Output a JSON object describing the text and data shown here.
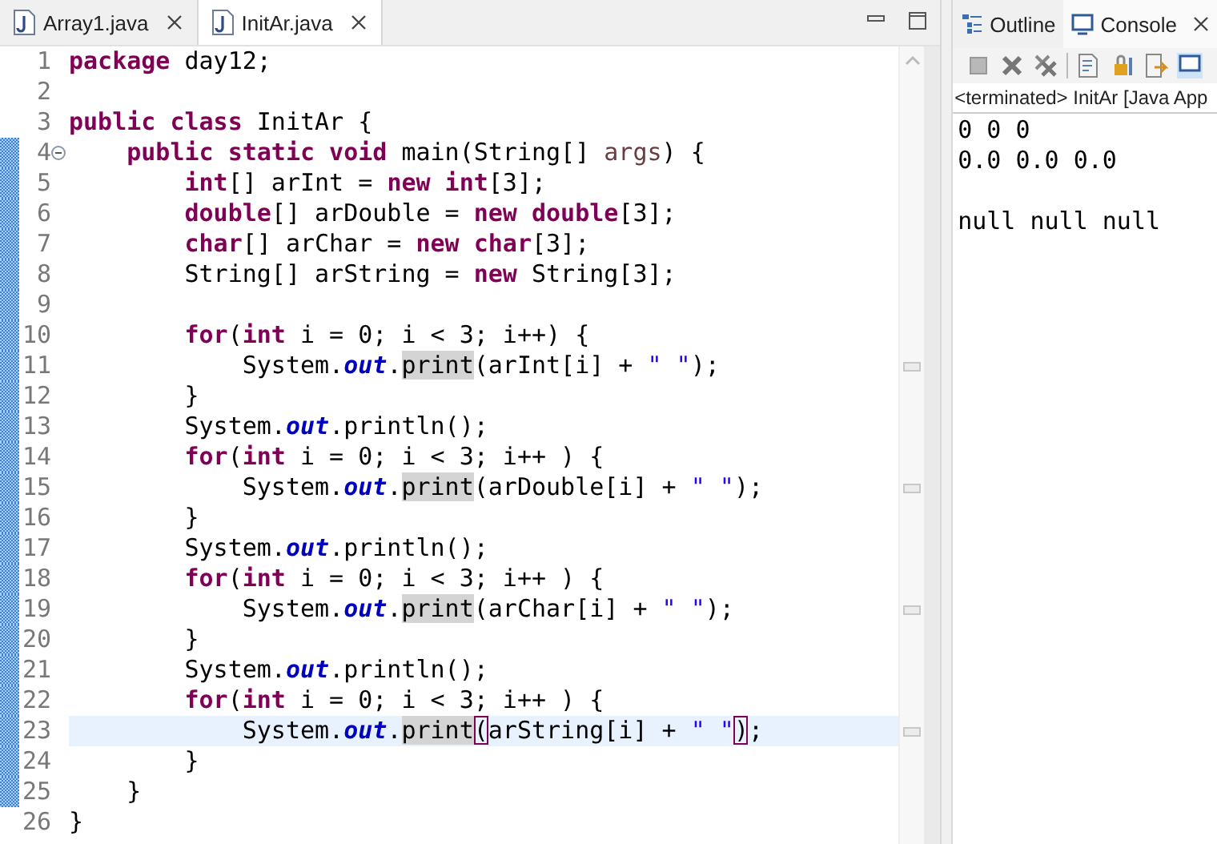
{
  "editor": {
    "tabs": [
      {
        "label": "Array1.java",
        "selected": false
      },
      {
        "label": "InitAr.java",
        "selected": true
      }
    ],
    "lines": [
      {
        "number": "1",
        "changed": false,
        "fold": false,
        "current": false,
        "tokens": [
          {
            "kind": "kw",
            "text": "package"
          },
          {
            "kind": "plain",
            "text": " day12;"
          }
        ]
      },
      {
        "number": "2",
        "changed": false,
        "fold": false,
        "current": false
      },
      {
        "number": "3",
        "changed": false,
        "fold": false,
        "current": false,
        "tokens": [
          {
            "kind": "kw",
            "text": "public class"
          },
          {
            "kind": "plain",
            "text": " InitAr {"
          }
        ]
      },
      {
        "number": "4",
        "changed": true,
        "fold": true,
        "current": false,
        "tokens": [
          {
            "kind": "kw",
            "text": "    public static void"
          },
          {
            "kind": "plain",
            "text": " main(String[] "
          },
          {
            "kind": "param",
            "text": "args"
          },
          {
            "kind": "plain",
            "text": ") {"
          }
        ]
      },
      {
        "number": "5",
        "changed": true,
        "fold": false,
        "current": false,
        "tokens": [
          {
            "kind": "kw",
            "text": "        int"
          },
          {
            "kind": "plain",
            "text": "[] arInt = "
          },
          {
            "kind": "kw",
            "text": "new int"
          },
          {
            "kind": "plain",
            "text": "[3];"
          }
        ]
      },
      {
        "number": "6",
        "changed": true,
        "fold": false,
        "current": false,
        "tokens": [
          {
            "kind": "kw",
            "text": "        double"
          },
          {
            "kind": "plain",
            "text": "[] arDouble = "
          },
          {
            "kind": "kw",
            "text": "new double"
          },
          {
            "kind": "plain",
            "text": "[3];"
          }
        ]
      },
      {
        "number": "7",
        "changed": true,
        "fold": false,
        "current": false,
        "tokens": [
          {
            "kind": "kw",
            "text": "        char"
          },
          {
            "kind": "plain",
            "text": "[] arChar = "
          },
          {
            "kind": "kw",
            "text": "new char"
          },
          {
            "kind": "plain",
            "text": "[3];"
          }
        ]
      },
      {
        "number": "8",
        "changed": true,
        "fold": false,
        "current": false,
        "tokens": [
          {
            "kind": "plain",
            "text": "        String[] arString = "
          },
          {
            "kind": "kw",
            "text": "new"
          },
          {
            "kind": "plain",
            "text": " String[3];"
          }
        ]
      },
      {
        "number": "9",
        "changed": true,
        "fold": false,
        "current": false
      },
      {
        "number": "10",
        "changed": true,
        "fold": false,
        "current": false,
        "tokens": [
          {
            "kind": "kw",
            "text": "        for"
          },
          {
            "kind": "plain",
            "text": "("
          },
          {
            "kind": "kw",
            "text": "int"
          },
          {
            "kind": "plain",
            "text": " i = 0; i < 3; i++) {"
          }
        ]
      },
      {
        "number": "11",
        "changed": true,
        "fold": false,
        "current": false,
        "tokens": [
          {
            "kind": "plain",
            "text": "            System."
          },
          {
            "kind": "static",
            "text": "out"
          },
          {
            "kind": "plain",
            "text": "."
          },
          {
            "kind": "occurrence",
            "text": "print"
          },
          {
            "kind": "plain",
            "text": "(arInt[i] + "
          },
          {
            "kind": "str",
            "text": "\" \""
          },
          {
            "kind": "plain",
            "text": ");"
          }
        ]
      },
      {
        "number": "12",
        "changed": true,
        "fold": false,
        "current": false,
        "tokens": [
          {
            "kind": "plain",
            "text": "        }"
          }
        ]
      },
      {
        "number": "13",
        "changed": true,
        "fold": false,
        "current": false,
        "tokens": [
          {
            "kind": "plain",
            "text": "        System."
          },
          {
            "kind": "static",
            "text": "out"
          },
          {
            "kind": "plain",
            "text": ".println();"
          }
        ]
      },
      {
        "number": "14",
        "changed": true,
        "fold": false,
        "current": false,
        "tokens": [
          {
            "kind": "kw",
            "text": "        for"
          },
          {
            "kind": "plain",
            "text": "("
          },
          {
            "kind": "kw",
            "text": "int"
          },
          {
            "kind": "plain",
            "text": " i = 0; i < 3; i++ ) {"
          }
        ]
      },
      {
        "number": "15",
        "changed": true,
        "fold": false,
        "current": false,
        "tokens": [
          {
            "kind": "plain",
            "text": "            System."
          },
          {
            "kind": "static",
            "text": "out"
          },
          {
            "kind": "plain",
            "text": "."
          },
          {
            "kind": "occurrence",
            "text": "print"
          },
          {
            "kind": "plain",
            "text": "(arDouble[i] + "
          },
          {
            "kind": "str",
            "text": "\" \""
          },
          {
            "kind": "plain",
            "text": ");"
          }
        ]
      },
      {
        "number": "16",
        "changed": true,
        "fold": false,
        "current": false,
        "tokens": [
          {
            "kind": "plain",
            "text": "        }"
          }
        ]
      },
      {
        "number": "17",
        "changed": true,
        "fold": false,
        "current": false,
        "tokens": [
          {
            "kind": "plain",
            "text": "        System."
          },
          {
            "kind": "static",
            "text": "out"
          },
          {
            "kind": "plain",
            "text": ".println();"
          }
        ]
      },
      {
        "number": "18",
        "changed": true,
        "fold": false,
        "current": false,
        "tokens": [
          {
            "kind": "kw",
            "text": "        for"
          },
          {
            "kind": "plain",
            "text": "("
          },
          {
            "kind": "kw",
            "text": "int"
          },
          {
            "kind": "plain",
            "text": " i = 0; i < 3; i++ ) {"
          }
        ]
      },
      {
        "number": "19",
        "changed": true,
        "fold": false,
        "current": false,
        "tokens": [
          {
            "kind": "plain",
            "text": "            System."
          },
          {
            "kind": "static",
            "text": "out"
          },
          {
            "kind": "plain",
            "text": "."
          },
          {
            "kind": "occurrence",
            "text": "print"
          },
          {
            "kind": "plain",
            "text": "(arChar[i] + "
          },
          {
            "kind": "str",
            "text": "\" \""
          },
          {
            "kind": "plain",
            "text": ");"
          }
        ]
      },
      {
        "number": "20",
        "changed": true,
        "fold": false,
        "current": false,
        "tokens": [
          {
            "kind": "plain",
            "text": "        }"
          }
        ]
      },
      {
        "number": "21",
        "changed": true,
        "fold": false,
        "current": false,
        "tokens": [
          {
            "kind": "plain",
            "text": "        System."
          },
          {
            "kind": "static",
            "text": "out"
          },
          {
            "kind": "plain",
            "text": ".println();"
          }
        ]
      },
      {
        "number": "22",
        "changed": true,
        "fold": false,
        "current": false,
        "tokens": [
          {
            "kind": "kw",
            "text": "        for"
          },
          {
            "kind": "plain",
            "text": "("
          },
          {
            "kind": "kw",
            "text": "int"
          },
          {
            "kind": "plain",
            "text": " i = 0; i < 3; i++ ) {"
          }
        ]
      },
      {
        "number": "23",
        "changed": true,
        "fold": false,
        "current": true,
        "tokens": [
          {
            "kind": "plain",
            "text": "            System."
          },
          {
            "kind": "static",
            "text": "out"
          },
          {
            "kind": "plain",
            "text": "."
          },
          {
            "kind": "occurrence",
            "text": "print"
          },
          {
            "kind": "bracket",
            "text": "("
          },
          {
            "kind": "plain",
            "text": "arString[i] + "
          },
          {
            "kind": "str",
            "text": "\" \""
          },
          {
            "kind": "bracket",
            "text": ")"
          },
          {
            "kind": "plain",
            "text": ";"
          }
        ]
      },
      {
        "number": "24",
        "changed": true,
        "fold": false,
        "current": false,
        "tokens": [
          {
            "kind": "plain",
            "text": "        }"
          }
        ]
      },
      {
        "number": "25",
        "changed": true,
        "fold": false,
        "current": false,
        "tokens": [
          {
            "kind": "plain",
            "text": "    }"
          }
        ]
      },
      {
        "number": "26",
        "changed": false,
        "fold": false,
        "current": false,
        "tokens": [
          {
            "kind": "plain",
            "text": "}"
          }
        ]
      }
    ]
  },
  "side_panel": {
    "tabs": [
      {
        "label": "Outline",
        "selected": false
      },
      {
        "label": "Console",
        "selected": true
      }
    ],
    "console_header": "<terminated> InitAr [Java App",
    "output": [
      {
        "text": "0 0 0",
        "blank_before": false
      },
      {
        "text": "0.0 0.0 0.0",
        "blank_before": false
      },
      {
        "text": "null null null",
        "blank_before": true
      }
    ]
  }
}
